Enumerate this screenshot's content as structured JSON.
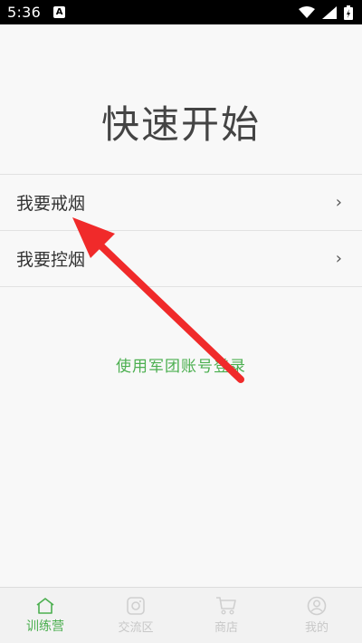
{
  "status": {
    "time": "5:36",
    "notif_letter": "A"
  },
  "main": {
    "title": "快速开始",
    "items": [
      {
        "label": "我要戒烟",
        "chevron": "›"
      },
      {
        "label": "我要控烟",
        "chevron": "›"
      }
    ],
    "login_link": "使用军团账号登录"
  },
  "tabbar": {
    "tabs": [
      {
        "label": "训练营",
        "icon": "home-icon",
        "active": true
      },
      {
        "label": "交流区",
        "icon": "camera-icon",
        "active": false
      },
      {
        "label": "商店",
        "icon": "cart-icon",
        "active": false
      },
      {
        "label": "我的",
        "icon": "user-icon",
        "active": false
      }
    ]
  },
  "colors": {
    "accent": "#4caf50",
    "annotation_arrow": "#f02a2a"
  },
  "annotation": {
    "type": "red-arrow",
    "points_to": "我要戒烟"
  }
}
